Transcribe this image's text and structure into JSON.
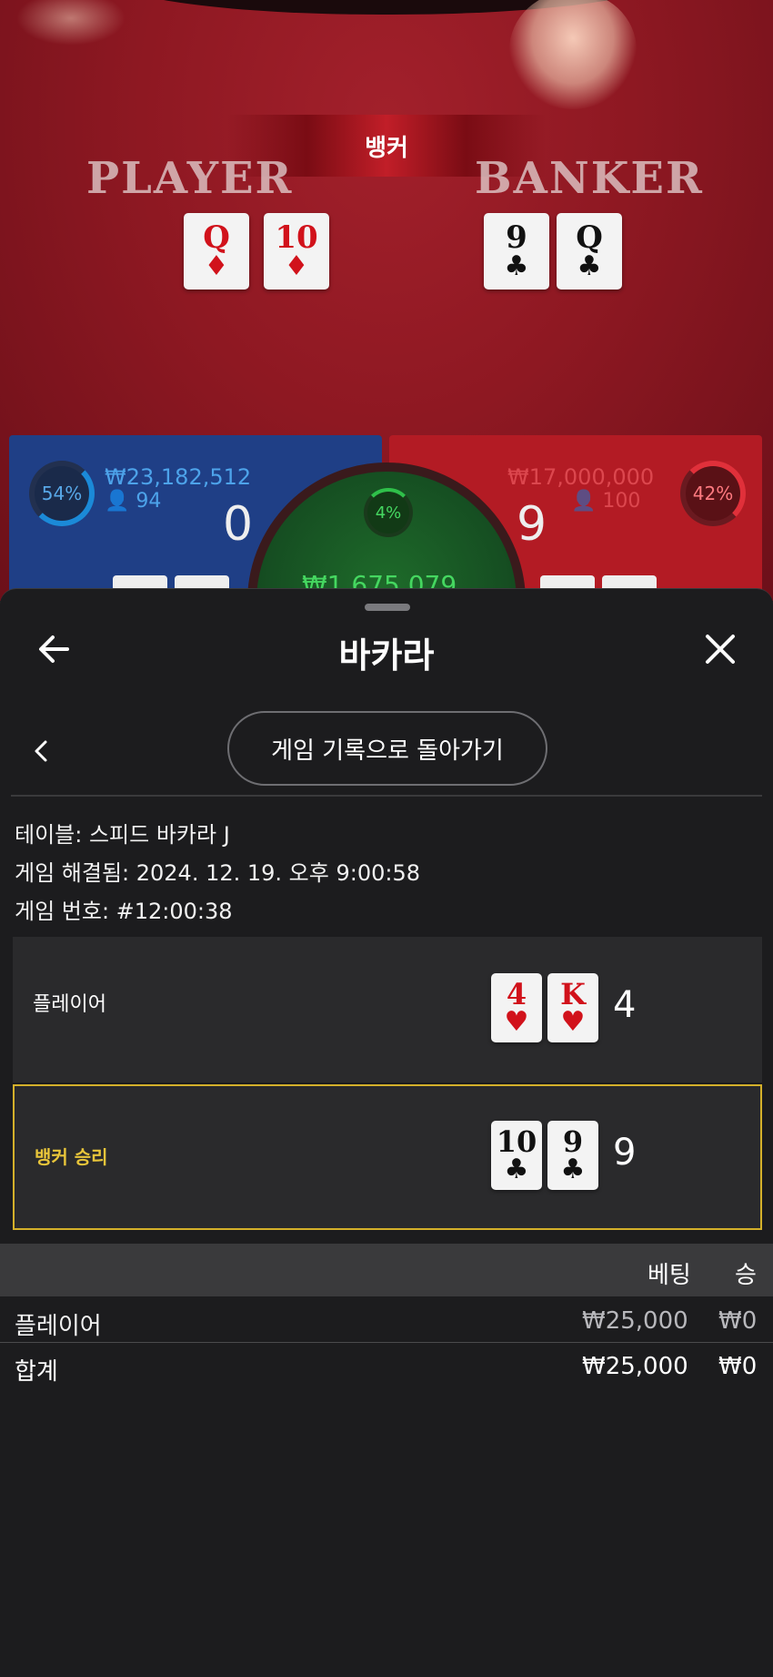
{
  "game": {
    "result_banner": "뱅커",
    "player_word": "PLAYER",
    "banker_word": "BANKER",
    "table_cards": {
      "player": [
        {
          "rank": "Q",
          "suit": "♦",
          "color": "red"
        },
        {
          "rank": "10",
          "suit": "♦",
          "color": "red"
        }
      ],
      "banker": [
        {
          "rank": "9",
          "suit": "♣",
          "color": "black"
        },
        {
          "rank": "Q",
          "suit": "♣",
          "color": "black"
        }
      ]
    },
    "player_panel": {
      "percent": "54%",
      "amount": "₩23,182,512",
      "bettors": "94",
      "score": "0",
      "color": "#1f3f86"
    },
    "banker_panel": {
      "percent": "42%",
      "amount": "₩17,000,000",
      "bettors": "100",
      "score": "9",
      "color": "#b31b24"
    },
    "tie_panel": {
      "percent": "4%",
      "amount": "₩1,675,079",
      "color": "#1e6b2a"
    }
  },
  "sheet": {
    "title": "바카라",
    "back_to_history": "게임 기록으로 돌아가기",
    "info": {
      "table": "테이블: 스피드 바카라 J",
      "resolved": "게임 해결됨: 2024. 12. 19. 오후 9:00:58",
      "number": "게임 번호: #12:00:38"
    },
    "hands": {
      "player": {
        "label": "플레이어",
        "score": "4",
        "cards": [
          {
            "rank": "4",
            "suit": "♥",
            "color": "red"
          },
          {
            "rank": "K",
            "suit": "♥",
            "color": "red"
          }
        ]
      },
      "banker": {
        "label": "뱅커 승리",
        "score": "9",
        "cards": [
          {
            "rank": "10",
            "suit": "♣",
            "color": "black"
          },
          {
            "rank": "9",
            "suit": "♣",
            "color": "black"
          }
        ]
      }
    },
    "table": {
      "columns": [
        "베팅",
        "승"
      ],
      "rows": [
        {
          "label": "플레이어",
          "bet": "₩25,000",
          "win": "₩0"
        },
        {
          "label": "합계",
          "bet": "₩25,000",
          "win": "₩0"
        }
      ]
    },
    "colors": {
      "winner_border": "#d4b02a",
      "winner_text": "#e8c53a"
    }
  }
}
